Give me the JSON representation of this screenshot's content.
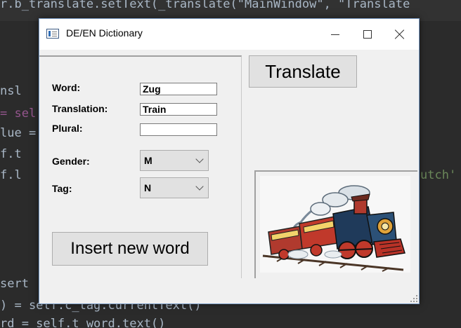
{
  "editor": {
    "lines": [
      {
        "text": "r.b_translate.setText(_translate(\"MainWindow\", \"Translate",
        "color": "#a9b7c6"
      },
      {
        "text": "nsl",
        "color": "#a9b7c6"
      },
      {
        "text": "= sel",
        "color": "#94558d"
      },
      {
        "text": "lue =",
        "color": "#a9b7c6"
      },
      {
        "text": "f.t",
        "color": "#a9b7c6"
      },
      {
        "text": "f.l",
        "color": "#a9b7c6"
      },
      {
        "text": "utch'",
        "color": "#6a8759"
      },
      {
        "text": "sert",
        "color": "#a9b7c6"
      },
      {
        "text": ") = self.c_tag.currentText()",
        "color": "#a9b7c6"
      },
      {
        "text": "rd = self.t_word.text()",
        "color": "#a9b7c6"
      }
    ]
  },
  "window": {
    "title": "DE/EN Dictionary",
    "controls": {
      "minimize": "—",
      "maximize": "☐",
      "close": "✕"
    }
  },
  "form": {
    "word_label": "Word:",
    "word_value": "Zug",
    "translation_label": "Translation:",
    "translation_value": "Train",
    "plural_label": "Plural:",
    "plural_value": "",
    "gender_label": "Gender:",
    "gender_value": "M",
    "tag_label": "Tag:",
    "tag_value": "N"
  },
  "buttons": {
    "translate": "Translate",
    "insert": "Insert new word"
  },
  "image": {
    "icon": "steam-train-image"
  }
}
